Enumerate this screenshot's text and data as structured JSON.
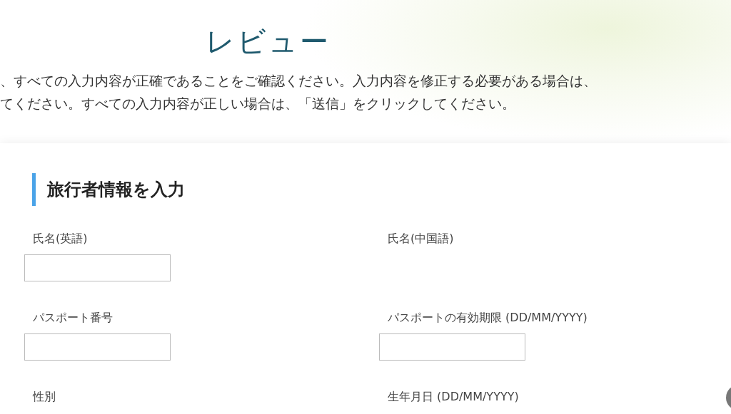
{
  "page": {
    "title": "レビュー",
    "instructions": [
      "、すべての入力内容が正確であることをご確認ください。入力内容を修正する必要がある場合は、",
      "てください。すべての入力内容が正しい場合は、「送信」をクリックしてください。"
    ]
  },
  "section": {
    "heading": "旅行者情報を入力",
    "fields": [
      {
        "label": "氏名(英語)",
        "kind": "input"
      },
      {
        "label": "氏名(中国語)",
        "kind": "label-only"
      },
      {
        "label": "パスポート番号",
        "kind": "input"
      },
      {
        "label": "パスポートの有効期限 (DD/MM/YYYY)",
        "kind": "input"
      },
      {
        "label": "性別",
        "kind": "label-only"
      },
      {
        "label": "生年月日 (DD/MM/YYYY)",
        "kind": "label-only"
      }
    ]
  }
}
